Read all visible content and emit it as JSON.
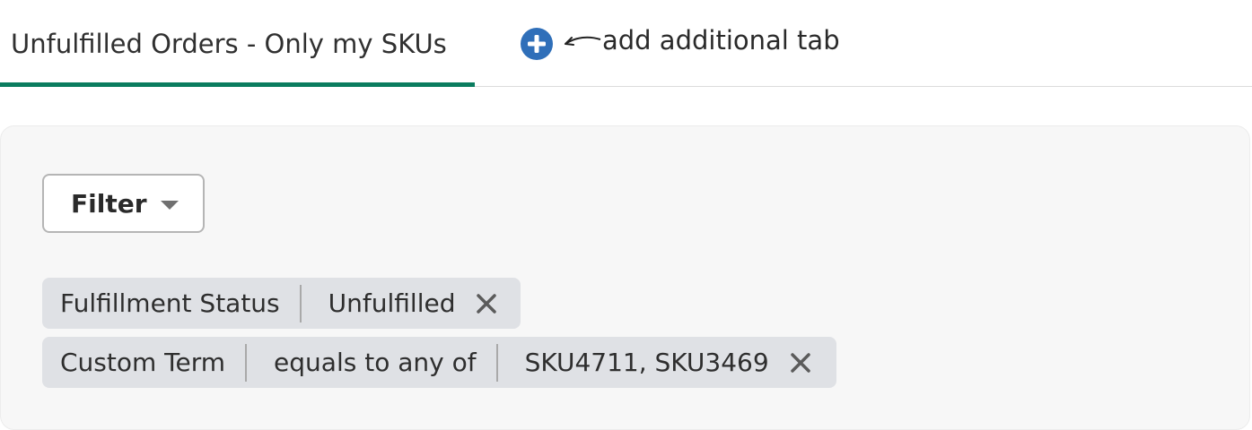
{
  "tabs": [
    {
      "label": "Unfulfilled Orders - Only my SKUs",
      "active": true
    }
  ],
  "add_tab": {
    "icon": "plus-circle-icon",
    "annotation": "add additional tab",
    "color": "#2f6fb9"
  },
  "filter_button": {
    "label": "Filter",
    "icon": "caret-down-icon"
  },
  "active_filters": [
    {
      "field": "Fulfillment Status",
      "value": "Unfulfilled"
    },
    {
      "field": "Custom Term",
      "operator": "equals to any of",
      "value": "SKU4711, SKU3469"
    }
  ],
  "colors": {
    "accent": "#0a7c5f",
    "chip_bg": "#dfe1e5",
    "panel_bg": "#f7f7f7"
  }
}
